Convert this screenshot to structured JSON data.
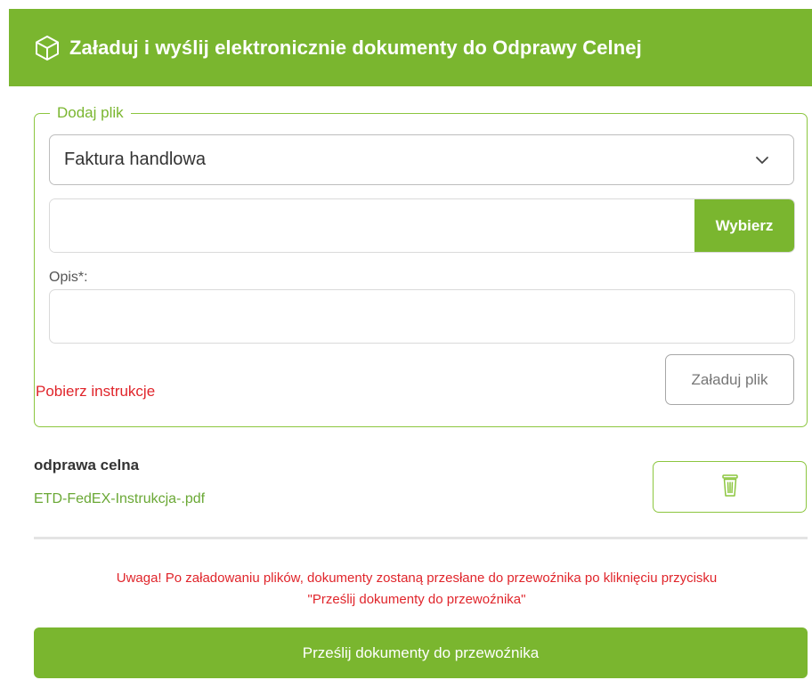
{
  "header": {
    "title": "Załaduj i wyślij elektronicznie dokumenty do Odprawy Celnej",
    "icon": "cube-icon"
  },
  "upload_form": {
    "legend": "Dodaj plik",
    "document_type": {
      "selected": "Faktura handlowa",
      "icon": "chevron-down-icon"
    },
    "file_input": {
      "value": "",
      "placeholder": ""
    },
    "choose_label": "Wybierz",
    "description_label": "Opis*:",
    "description_value": "",
    "upload_label": "Załaduj plik",
    "instructions_link": "Pobierz instrukcje"
  },
  "uploaded": {
    "title": "odprawa celna",
    "file_name": "ETD-FedEX-Instrukcja-.pdf",
    "delete_icon": "trash-icon"
  },
  "warning": {
    "line1": "Uwaga! Po załadowaniu plików, dokumenty zostaną przesłane do przewoźnika po kliknięciu przycisku",
    "line2": "\"Prześlij dokumenty do przewoźnika\""
  },
  "send_label": "Prześlij dokumenty do przewoźnika",
  "colors": {
    "accent": "#7ab62f",
    "danger": "#e0252b",
    "border": "#8cc63f"
  }
}
